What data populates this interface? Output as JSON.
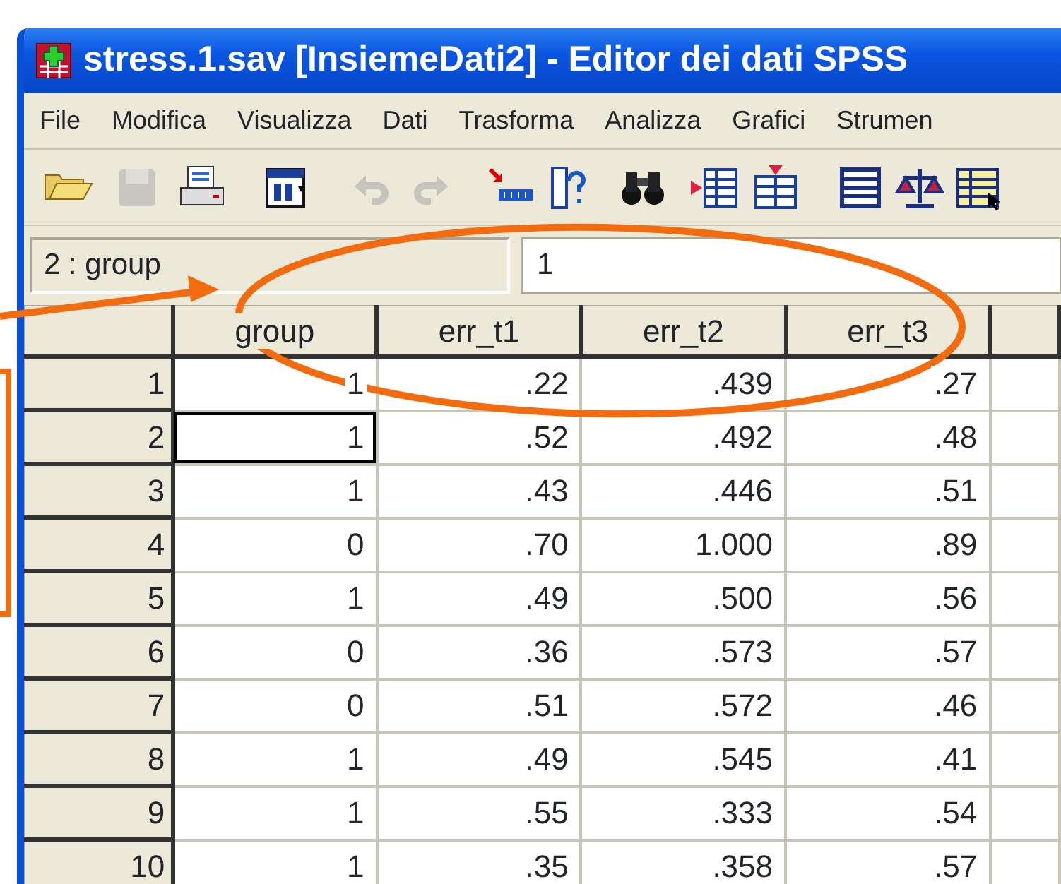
{
  "window": {
    "title": "stress.1.sav [InsiemeDati2] - Editor dei dati SPSS"
  },
  "menu": [
    "File",
    "Modifica",
    "Visualizza",
    "Dati",
    "Trasforma",
    "Analizza",
    "Grafici",
    "Strumen"
  ],
  "toolbar": [
    {
      "kind": "open",
      "disabled": false
    },
    {
      "kind": "save",
      "disabled": true
    },
    {
      "kind": "print",
      "disabled": false
    },
    {
      "kind": "dialog",
      "disabled": false
    },
    {
      "kind": "undo",
      "disabled": true
    },
    {
      "kind": "redo",
      "disabled": true
    },
    {
      "kind": "goto",
      "disabled": false
    },
    {
      "kind": "variables",
      "disabled": false
    },
    {
      "kind": "find",
      "disabled": false
    },
    {
      "kind": "insert-case",
      "disabled": false
    },
    {
      "kind": "insert-variable",
      "disabled": false
    },
    {
      "kind": "split",
      "disabled": false
    },
    {
      "kind": "weight",
      "disabled": false
    },
    {
      "kind": "select",
      "disabled": false
    }
  ],
  "cell_editor": {
    "reference": "2 : group",
    "value": "1"
  },
  "table": {
    "columns": [
      "group",
      "err_t1",
      "err_t2",
      "err_t3"
    ],
    "rows": [
      {
        "number": "1",
        "cells": [
          {
            "text": "1",
            "selected": false
          },
          {
            "text": ".22",
            "selected": false
          },
          {
            "text": ".439",
            "selected": false
          },
          {
            "text": ".27",
            "selected": false
          }
        ]
      },
      {
        "number": "2",
        "cells": [
          {
            "text": "1",
            "selected": true
          },
          {
            "text": ".52",
            "selected": false
          },
          {
            "text": ".492",
            "selected": false
          },
          {
            "text": ".48",
            "selected": false
          }
        ]
      },
      {
        "number": "3",
        "cells": [
          {
            "text": "1",
            "selected": false
          },
          {
            "text": ".43",
            "selected": false
          },
          {
            "text": ".446",
            "selected": false
          },
          {
            "text": ".51",
            "selected": false
          }
        ]
      },
      {
        "number": "4",
        "cells": [
          {
            "text": "0",
            "selected": false
          },
          {
            "text": ".70",
            "selected": false
          },
          {
            "text": "1.000",
            "selected": false
          },
          {
            "text": ".89",
            "selected": false
          }
        ]
      },
      {
        "number": "5",
        "cells": [
          {
            "text": "1",
            "selected": false
          },
          {
            "text": ".49",
            "selected": false
          },
          {
            "text": ".500",
            "selected": false
          },
          {
            "text": ".56",
            "selected": false
          }
        ]
      },
      {
        "number": "6",
        "cells": [
          {
            "text": "0",
            "selected": false
          },
          {
            "text": ".36",
            "selected": false
          },
          {
            "text": ".573",
            "selected": false
          },
          {
            "text": ".57",
            "selected": false
          }
        ]
      },
      {
        "number": "7",
        "cells": [
          {
            "text": "0",
            "selected": false
          },
          {
            "text": ".51",
            "selected": false
          },
          {
            "text": ".572",
            "selected": false
          },
          {
            "text": ".46",
            "selected": false
          }
        ]
      },
      {
        "number": "8",
        "cells": [
          {
            "text": "1",
            "selected": false
          },
          {
            "text": ".49",
            "selected": false
          },
          {
            "text": ".545",
            "selected": false
          },
          {
            "text": ".41",
            "selected": false
          }
        ]
      },
      {
        "number": "9",
        "cells": [
          {
            "text": "1",
            "selected": false
          },
          {
            "text": ".55",
            "selected": false
          },
          {
            "text": ".333",
            "selected": false
          },
          {
            "text": ".54",
            "selected": false
          }
        ]
      },
      {
        "number": "10",
        "cells": [
          {
            "text": "1",
            "selected": false
          },
          {
            "text": ".35",
            "selected": false
          },
          {
            "text": ".358",
            "selected": false
          },
          {
            "text": ".57",
            "selected": false
          }
        ]
      }
    ]
  },
  "annotations": [
    {
      "kind": "ellipse"
    },
    {
      "kind": "arrow"
    },
    {
      "kind": "bracket"
    }
  ]
}
